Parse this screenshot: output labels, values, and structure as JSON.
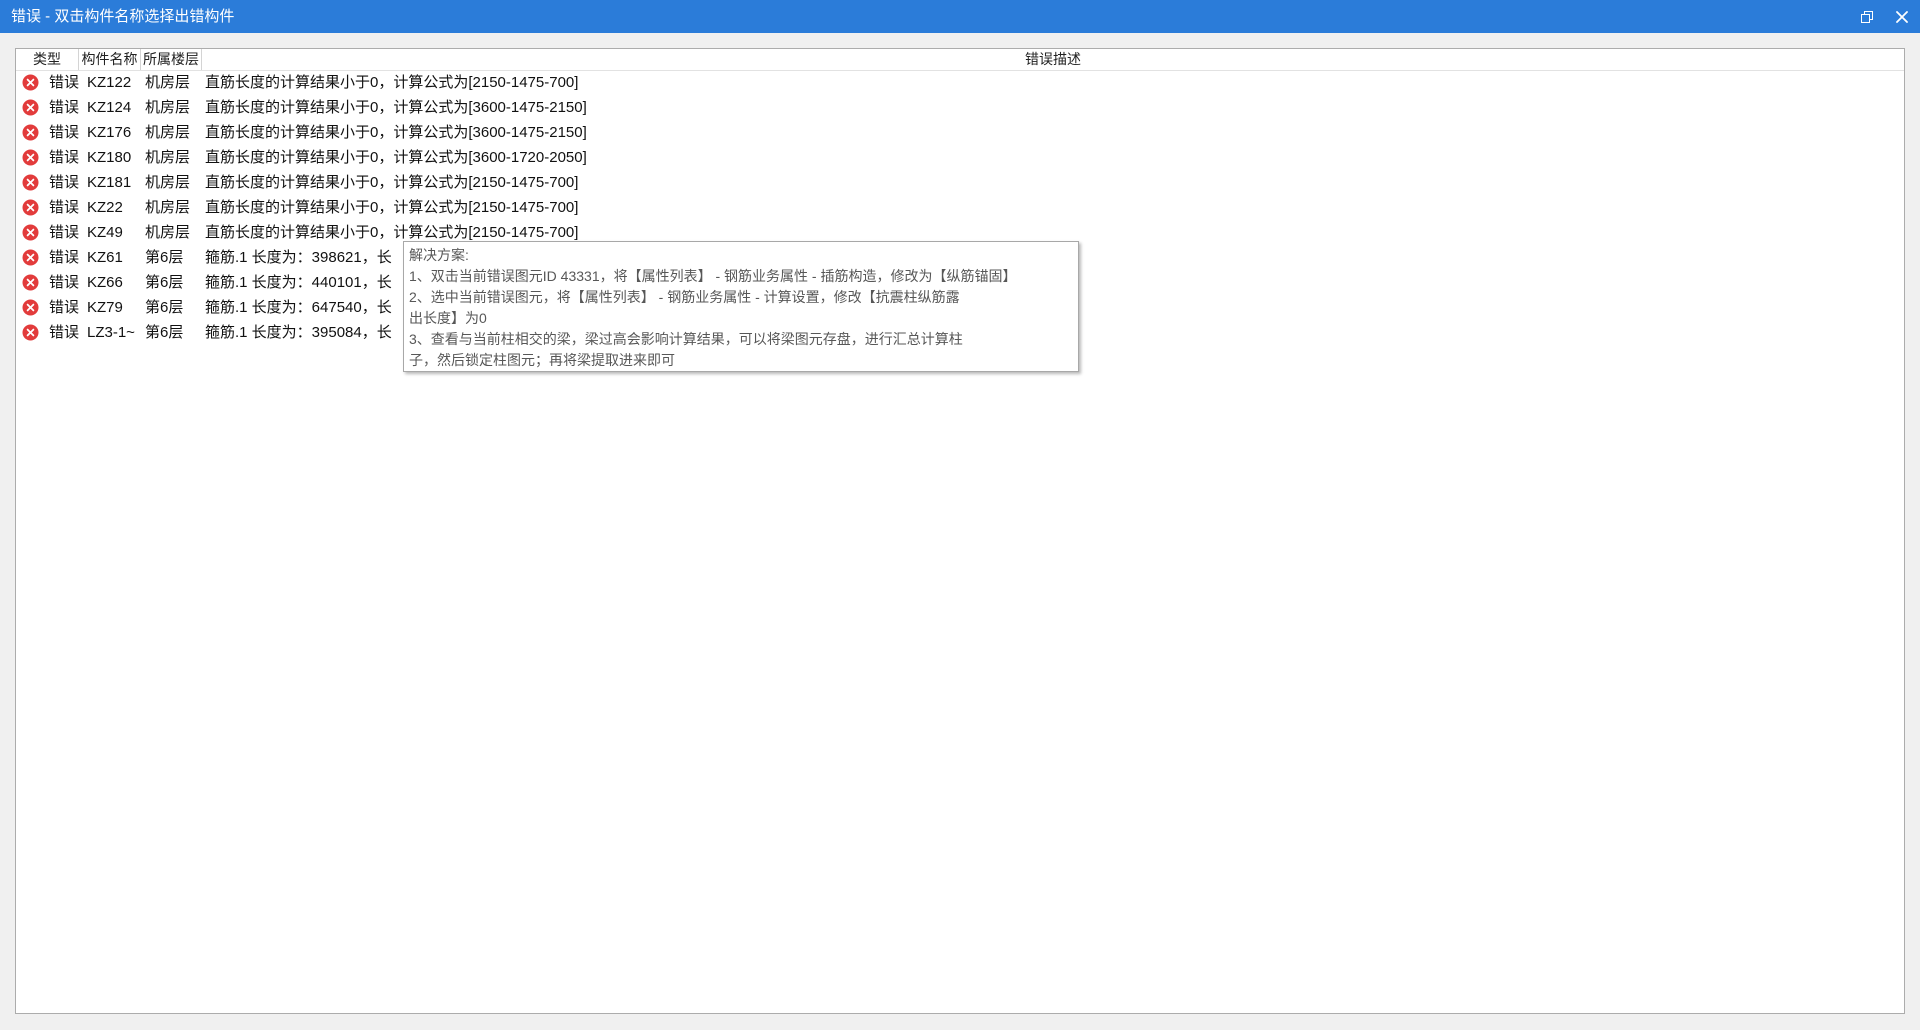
{
  "window": {
    "title": "错误 - 双击构件名称选择出错构件"
  },
  "icons": {
    "error": "error-icon",
    "restore": "restore-icon",
    "close": "close-icon"
  },
  "colors": {
    "titlebar": "#2b7cd9",
    "error_icon": "#e23b3b"
  },
  "table": {
    "columns": [
      "类型",
      "构件名称",
      "所属楼层",
      "错误描述"
    ],
    "rows": [
      {
        "type": "错误",
        "name": "KZ122",
        "floor": "机房层",
        "description": "直筋长度的计算结果小于0，计算公式为[2150-1475-700]"
      },
      {
        "type": "错误",
        "name": "KZ124",
        "floor": "机房层",
        "description": "直筋长度的计算结果小于0，计算公式为[3600-1475-2150]"
      },
      {
        "type": "错误",
        "name": "KZ176",
        "floor": "机房层",
        "description": "直筋长度的计算结果小于0，计算公式为[3600-1475-2150]"
      },
      {
        "type": "错误",
        "name": "KZ180",
        "floor": "机房层",
        "description": "直筋长度的计算结果小于0，计算公式为[3600-1720-2050]"
      },
      {
        "type": "错误",
        "name": "KZ181",
        "floor": "机房层",
        "description": "直筋长度的计算结果小于0，计算公式为[2150-1475-700]"
      },
      {
        "type": "错误",
        "name": "KZ22",
        "floor": "机房层",
        "description": "直筋长度的计算结果小于0，计算公式为[2150-1475-700]"
      },
      {
        "type": "错误",
        "name": "KZ49",
        "floor": "机房层",
        "description": "直筋长度的计算结果小于0，计算公式为[2150-1475-700]"
      },
      {
        "type": "错误",
        "name": "KZ61",
        "floor": "第6层",
        "description": "箍筋.1 长度为：398621，长"
      },
      {
        "type": "错误",
        "name": "KZ66",
        "floor": "第6层",
        "description": "箍筋.1 长度为：440101，长"
      },
      {
        "type": "错误",
        "name": "KZ79",
        "floor": "第6层",
        "description": "箍筋.1 长度为：647540，长"
      },
      {
        "type": "错误",
        "name": "LZ3-1~",
        "floor": "第6层",
        "description": "箍筋.1 长度为：395084，长"
      }
    ]
  },
  "tooltip": {
    "lines": [
      "解决方案:",
      "1、双击当前错误图元ID 43331，将【属性列表】 - 钢筋业务属性 - 插筋构造，修改为【纵筋锚固】",
      "2、选中当前错误图元，将【属性列表】 - 钢筋业务属性 - 计算设置，修改【抗震柱纵筋露",
      "出长度】为0",
      "3、查看与当前柱相交的梁，梁过高会影响计算结果，可以将梁图元存盘，进行汇总计算柱",
      "子，然后锁定柱图元；再将梁提取进来即可"
    ]
  }
}
